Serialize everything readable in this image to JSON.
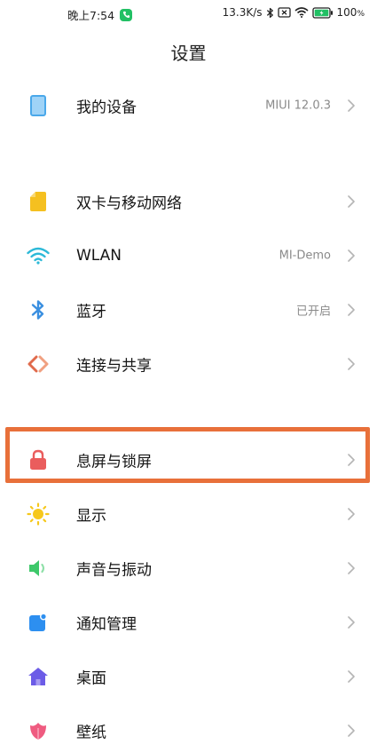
{
  "status_bar": {
    "time": "晚上7:54",
    "net_speed": "13.3K/s",
    "battery": "100",
    "battery_unit": "%",
    "icons": [
      "call-icon",
      "bluetooth-icon",
      "sim-x-icon",
      "wifi-icon",
      "battery-icon"
    ]
  },
  "header": {
    "title": "设置"
  },
  "items": {
    "my_device": {
      "label": "我的设备",
      "value": "MIUI 12.0.3",
      "icon": "phone-icon"
    },
    "sim": {
      "label": "双卡与移动网络",
      "icon": "sim-card-icon"
    },
    "wlan": {
      "label": "WLAN",
      "value": "MI-Demo",
      "icon": "wifi-icon"
    },
    "bluetooth": {
      "label": "蓝牙",
      "value": "已开启",
      "icon": "bluetooth-icon"
    },
    "connection": {
      "label": "连接与共享",
      "icon": "share-icon"
    },
    "lock": {
      "label": "息屏与锁屏",
      "icon": "lock-icon"
    },
    "display": {
      "label": "显示",
      "icon": "sun-icon"
    },
    "sound": {
      "label": "声音与振动",
      "icon": "speaker-icon"
    },
    "notification": {
      "label": "通知管理",
      "icon": "notification-icon"
    },
    "home": {
      "label": "桌面",
      "icon": "home-icon"
    },
    "wallpaper": {
      "label": "壁纸",
      "icon": "flower-icon"
    }
  },
  "colors": {
    "highlight": "#e8703a",
    "device": "#4aa8ea",
    "sim": "#f5c020",
    "wifi": "#2cb9d8",
    "bluetooth": "#3a8fe0",
    "share": "#e06a4c",
    "lock": "#ea5d5d",
    "display": "#f6c81c",
    "sound": "#3ec86a",
    "notification": "#2d8ff0",
    "home": "#6c5ce7",
    "wallpaper": "#ef5b80"
  }
}
